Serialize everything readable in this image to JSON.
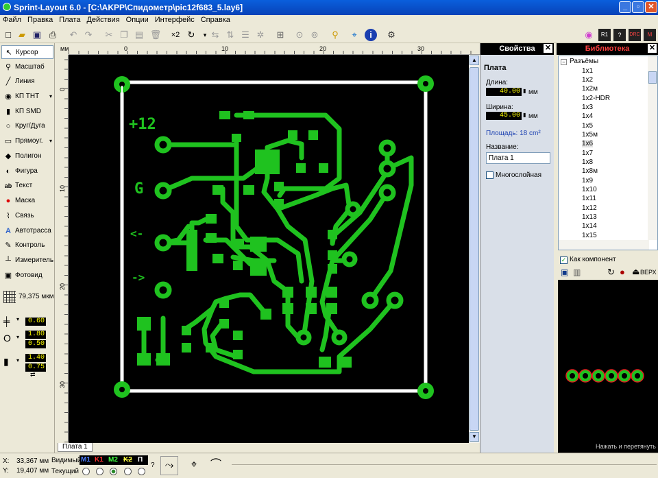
{
  "window": {
    "title": "Sprint-Layout 6.0 - [C:\\AKPP\\Спидометр\\pic12f683_5.lay6]",
    "min": "_",
    "restore": "▫",
    "close": "✕"
  },
  "menu": [
    "Файл",
    "Правка",
    "Плата",
    "Действия",
    "Опции",
    "Интерфейс",
    "Справка"
  ],
  "toolbar": {
    "x2_label": "×2"
  },
  "tools": [
    {
      "label": "Курсор",
      "icon": "cursor-icon",
      "glyph": "↖"
    },
    {
      "label": "Масштаб",
      "icon": "zoom-icon",
      "glyph": "⚲"
    },
    {
      "label": "Линия",
      "icon": "line-icon",
      "glyph": "╱"
    },
    {
      "label": "КП THT",
      "icon": "tht-pad-icon",
      "glyph": "◉"
    },
    {
      "label": "КП SMD",
      "icon": "smd-pad-icon",
      "glyph": "▮"
    },
    {
      "label": "Круг/Дуга",
      "icon": "circle-icon",
      "glyph": "○"
    },
    {
      "label": "Прямоуг.",
      "icon": "rectangle-icon",
      "glyph": "▭"
    },
    {
      "label": "Полигон",
      "icon": "polygon-icon",
      "glyph": "◆"
    },
    {
      "label": "Фигура",
      "icon": "figure-icon",
      "glyph": "◐"
    },
    {
      "label": "Текст",
      "icon": "text-icon",
      "glyph": "ab"
    },
    {
      "label": "Маска",
      "icon": "mask-icon",
      "glyph": "●"
    },
    {
      "label": "Связь",
      "icon": "connection-icon",
      "glyph": "⌇"
    },
    {
      "label": "Автотрасса",
      "icon": "autoroute-icon",
      "glyph": "A"
    },
    {
      "label": "Контроль",
      "icon": "control-icon",
      "glyph": "✎"
    },
    {
      "label": "Измеритель",
      "icon": "measure-icon",
      "glyph": "┴"
    },
    {
      "label": "Фотовид",
      "icon": "photoview-icon",
      "glyph": "▣"
    }
  ],
  "grid": {
    "value": "79,375 мкм"
  },
  "widths": {
    "track": "0.60",
    "pad_outer": "1.80",
    "pad_inner": "0.50",
    "smd_w": "1.40",
    "smd_h": "0.75"
  },
  "ruler": {
    "unit": "мм",
    "h_ticks": [
      "0",
      "10",
      "20",
      "30"
    ],
    "v_ticks": [
      "0",
      "10",
      "20",
      "30"
    ]
  },
  "silkscreen": {
    "plus12": "+12",
    "g": "G",
    "left_arrow": "<-",
    "right_arrow": "->"
  },
  "tab": {
    "label": "Плата 1"
  },
  "status": {
    "x_label": "X:",
    "x_value": "33,367 мм",
    "y_label": "Y:",
    "y_value": "19,407 мм",
    "visible_label": "Видимый",
    "current_label": "Текущий",
    "layers": [
      {
        "name": "M1",
        "color": "#4d7dff"
      },
      {
        "name": "K1",
        "color": "#ff3030"
      },
      {
        "name": "M2",
        "color": "#40ff40"
      },
      {
        "name": "K2",
        "color": "#ffff40"
      },
      {
        "name": "П",
        "color": "#ffffff"
      }
    ],
    "help": "?"
  },
  "properties": {
    "title": "Свойства",
    "section": "Плата",
    "length_label": "Длина:",
    "length_value": "40.00",
    "length_unit": "мм",
    "width_label": "Ширина:",
    "width_value": "45.00",
    "width_unit": "мм",
    "area": "Площадь:  18 cm²",
    "name_label": "Название:",
    "name_value": "Плата 1",
    "multilayer_label": "Многослойная"
  },
  "library": {
    "title": "Библиотека",
    "root": "Разъёмы",
    "items": [
      "1x1",
      "1x2",
      "1x2м",
      "1x2-HDR",
      "1x3",
      "1x4",
      "1x5",
      "1x5м",
      "1x6",
      "1x7",
      "1x8",
      "1x8м",
      "1x9",
      "1x10",
      "1x11",
      "1x12",
      "1x13",
      "1x14",
      "1x15"
    ],
    "as_component_label": "Как компонент",
    "top_label": "ВЕРХ",
    "drag_hint": "Нажать и перетянуть"
  },
  "colors": {
    "copper": "#1fc21f",
    "board_outline": "#ffffff",
    "canvas": "#000000",
    "title_bar": "#0a5fdc"
  }
}
